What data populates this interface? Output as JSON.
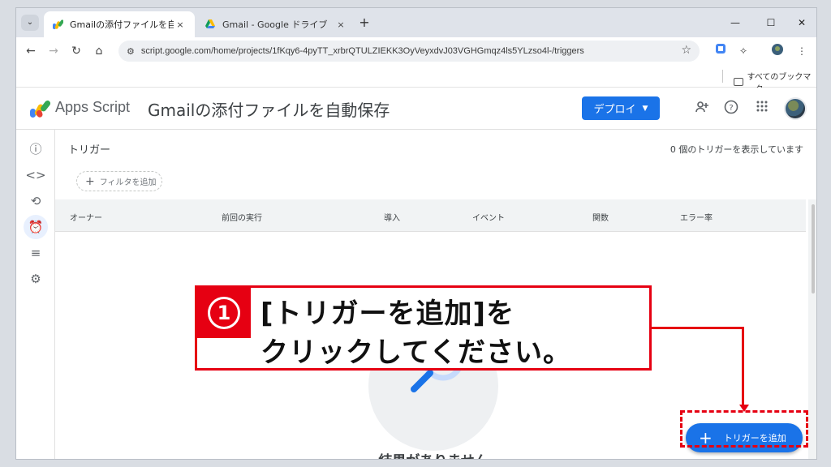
{
  "browser": {
    "tabs": [
      {
        "title": "Gmailの添付ファイルを自動保存 -",
        "active": true
      },
      {
        "title": "Gmail - Google ドライブ",
        "active": false
      }
    ],
    "close_glyph": "×",
    "new_tab_glyph": "+",
    "url": "script.google.com/home/projects/1fKqy6-4pyTT_xrbrQTULZIEKK3OyVeyxdvJ03VGHGmqz4ls5YLzso4l-/triggers",
    "bookmarks_all": "すべてのブックマーク"
  },
  "app": {
    "name": "Apps Script",
    "project": "Gmailの添付ファイルを自動保存",
    "deploy_label": "デプロイ"
  },
  "main": {
    "title": "トリガー",
    "count_text": "0 個のトリガーを表示しています",
    "filter_label": "フィルタを追加",
    "columns": [
      "オーナー",
      "前回の実行",
      "導入",
      "イベント",
      "関数",
      "エラー率"
    ],
    "empty_text": "結果がありません",
    "add_trigger_label": "トリガーを追加"
  },
  "annotation": {
    "number": "1",
    "line1": "[トリガーを追加]を",
    "line2": "クリックしてください。",
    "color": "#e60012"
  },
  "colors": {
    "accent": "#1a73e8",
    "annotation": "#e60012"
  }
}
